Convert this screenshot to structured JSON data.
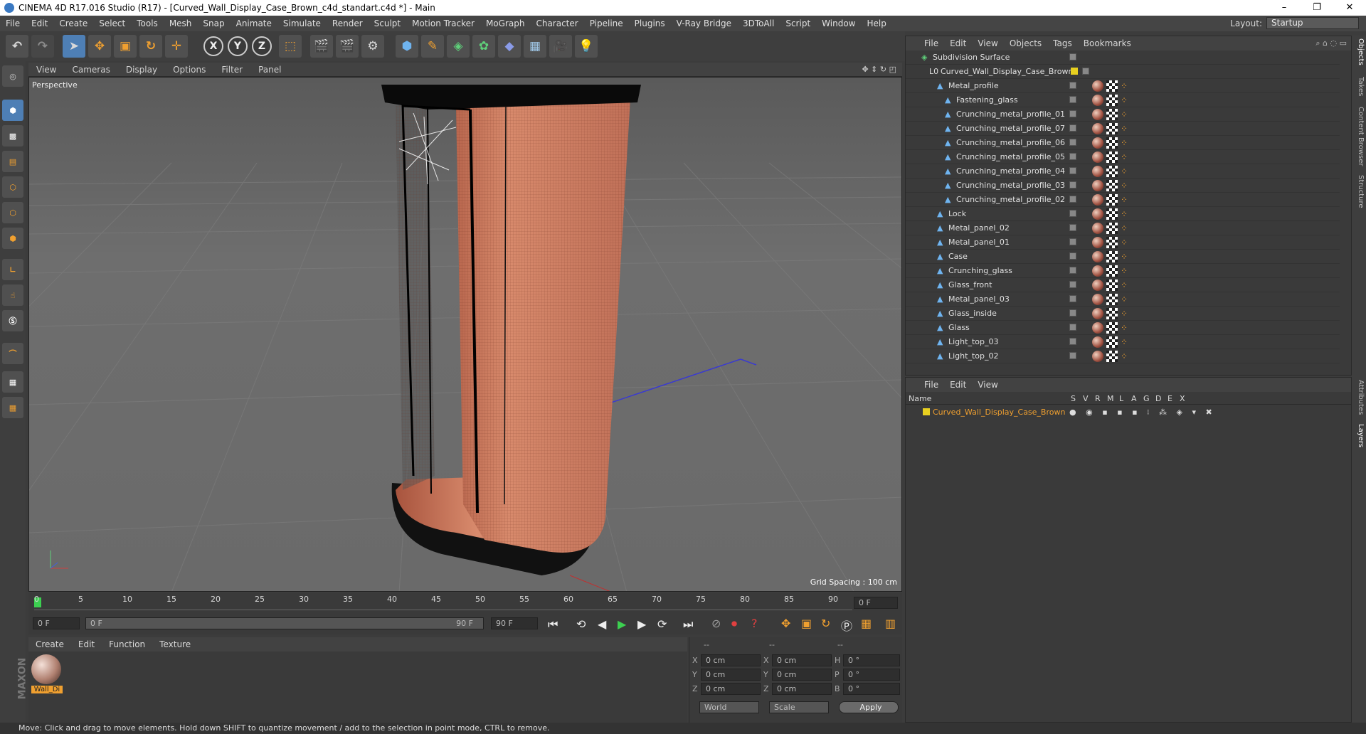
{
  "titlebar": {
    "title": "CINEMA 4D R17.016 Studio (R17) - [Curved_Wall_Display_Case_Brown_c4d_standart.c4d *] - Main",
    "minimize": "–",
    "maximize": "❐",
    "close": "✕"
  },
  "menubar": {
    "items": [
      "File",
      "Edit",
      "Create",
      "Select",
      "Tools",
      "Mesh",
      "Snap",
      "Animate",
      "Simulate",
      "Render",
      "Sculpt",
      "Motion Tracker",
      "MoGraph",
      "Character",
      "Pipeline",
      "Plugins",
      "V-Ray Bridge",
      "3DToAll",
      "Script",
      "Window",
      "Help"
    ],
    "layout_label": "Layout:",
    "layout_value": "Startup"
  },
  "toolbar": {
    "axis_x": "X",
    "axis_y": "Y",
    "axis_z": "Z"
  },
  "viewport": {
    "menu": [
      "View",
      "Cameras",
      "Display",
      "Options",
      "Filter",
      "Panel"
    ],
    "label": "Perspective",
    "grid_spacing": "Grid Spacing : 100 cm"
  },
  "timeline": {
    "ticks": [
      "0",
      "5",
      "10",
      "15",
      "20",
      "25",
      "30",
      "35",
      "40",
      "45",
      "50",
      "55",
      "60",
      "65",
      "70",
      "75",
      "80",
      "85",
      "90"
    ],
    "current_frame": "0 F",
    "start": "0 F",
    "range_start": "0 F",
    "range_end": "90 F",
    "end": "90 F"
  },
  "material": {
    "menu": [
      "Create",
      "Edit",
      "Function",
      "Texture"
    ],
    "name": "Wall_Di"
  },
  "coords": {
    "head1": "--",
    "head2": "--",
    "head3": "--",
    "rows": [
      {
        "a": "X",
        "av": "0 cm",
        "b": "X",
        "bv": "0 cm",
        "c": "H",
        "cv": "0 °"
      },
      {
        "a": "Y",
        "av": "0 cm",
        "b": "Y",
        "bv": "0 cm",
        "c": "P",
        "cv": "0 °"
      },
      {
        "a": "Z",
        "av": "0 cm",
        "b": "Z",
        "bv": "0 cm",
        "c": "B",
        "cv": "0 °"
      }
    ],
    "mode1": "World",
    "mode2": "Scale",
    "apply": "Apply"
  },
  "objects": {
    "menu": [
      "File",
      "Edit",
      "View",
      "Objects",
      "Tags",
      "Bookmarks"
    ],
    "items": [
      {
        "name": "Subdivision Surface",
        "indent": 0
      },
      {
        "name": "Curved_Wall_Display_Case_Brown",
        "indent": 1
      },
      {
        "name": "Metal_profile",
        "indent": 2
      },
      {
        "name": "Fastening_glass",
        "indent": 3
      },
      {
        "name": "Crunching_metal_profile_01",
        "indent": 3
      },
      {
        "name": "Crunching_metal_profile_07",
        "indent": 3
      },
      {
        "name": "Crunching_metal_profile_06",
        "indent": 3
      },
      {
        "name": "Crunching_metal_profile_05",
        "indent": 3
      },
      {
        "name": "Crunching_metal_profile_04",
        "indent": 3
      },
      {
        "name": "Crunching_metal_profile_03",
        "indent": 3
      },
      {
        "name": "Crunching_metal_profile_02",
        "indent": 3
      },
      {
        "name": "Lock",
        "indent": 2
      },
      {
        "name": "Metal_panel_02",
        "indent": 2
      },
      {
        "name": "Metal_panel_01",
        "indent": 2
      },
      {
        "name": "Case",
        "indent": 2
      },
      {
        "name": "Crunching_glass",
        "indent": 2
      },
      {
        "name": "Glass_front",
        "indent": 2
      },
      {
        "name": "Metal_panel_03",
        "indent": 2
      },
      {
        "name": "Glass_inside",
        "indent": 2
      },
      {
        "name": "Glass",
        "indent": 2
      },
      {
        "name": "Light_top_03",
        "indent": 2
      },
      {
        "name": "Light_top_02",
        "indent": 2
      }
    ]
  },
  "layers": {
    "menu": [
      "File",
      "Edit",
      "View"
    ],
    "col_name": "Name",
    "cols": [
      "S",
      "V",
      "R",
      "M",
      "L",
      "A",
      "G",
      "D",
      "E",
      "X"
    ],
    "row_name": "Curved_Wall_Display_Case_Brown"
  },
  "right_tabs": [
    "Objects",
    "Takes",
    "Content Browser",
    "Structure",
    "Attributes",
    "Layers"
  ],
  "status": "Move: Click and drag to move elements. Hold down SHIFT to quantize movement / add to the selection in point mode, CTRL to remove.",
  "colors": {
    "accent": "#f0a030",
    "layer_yellow": "#e8d020",
    "case_copper": "#c8735a"
  }
}
